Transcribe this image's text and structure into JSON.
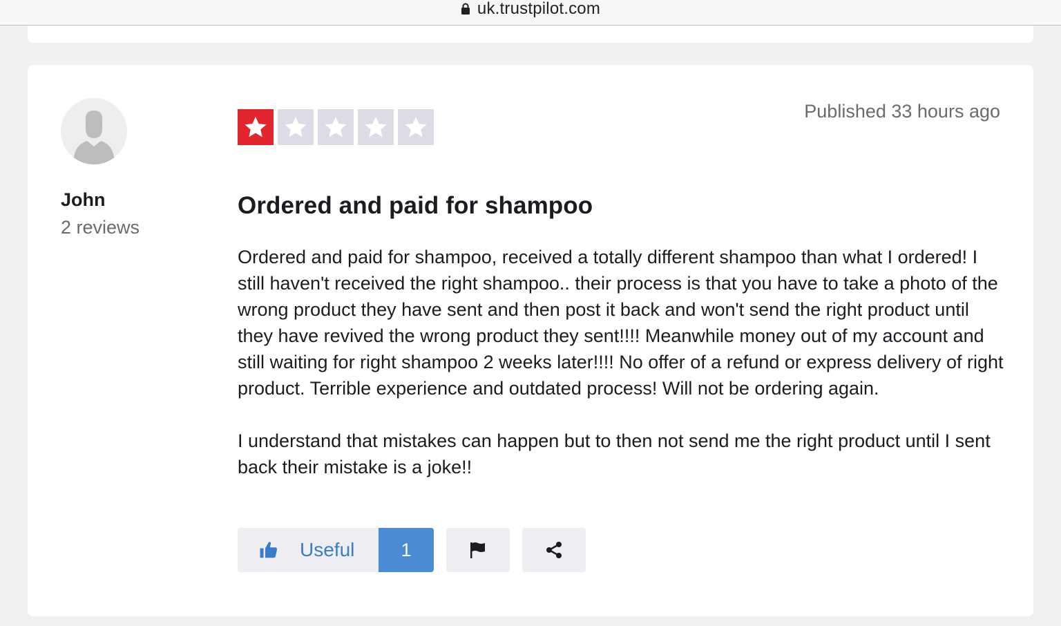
{
  "browser": {
    "url": "uk.trustpilot.com"
  },
  "review": {
    "consumer": {
      "name": "John",
      "reviews_count": "2 reviews"
    },
    "rating": 1,
    "rating_max": 5,
    "published": "Published 33 hours ago",
    "title": "Ordered and paid for shampoo",
    "body": [
      "Ordered and paid for shampoo, received a totally different shampoo than what I ordered! I still haven't received the right shampoo.. their process is that you have to take a photo of the wrong product they have sent and then post it back and won't send the right product until they have revived the wrong product they sent!!!! Meanwhile money out of my account and still waiting for right shampoo 2 weeks later!!!! No offer of a refund or express delivery of right product. Terrible experience and outdated process! Will not be ordering again.",
      "I understand that mistakes can happen but to then not send me the right product until I sent back their mistake is a joke!!"
    ],
    "actions": {
      "useful_label": "Useful",
      "useful_count": "1"
    }
  },
  "colors": {
    "star_filled": "#e1262e",
    "star_empty": "#dcdce6",
    "accent_blue": "#4a8bd3"
  }
}
